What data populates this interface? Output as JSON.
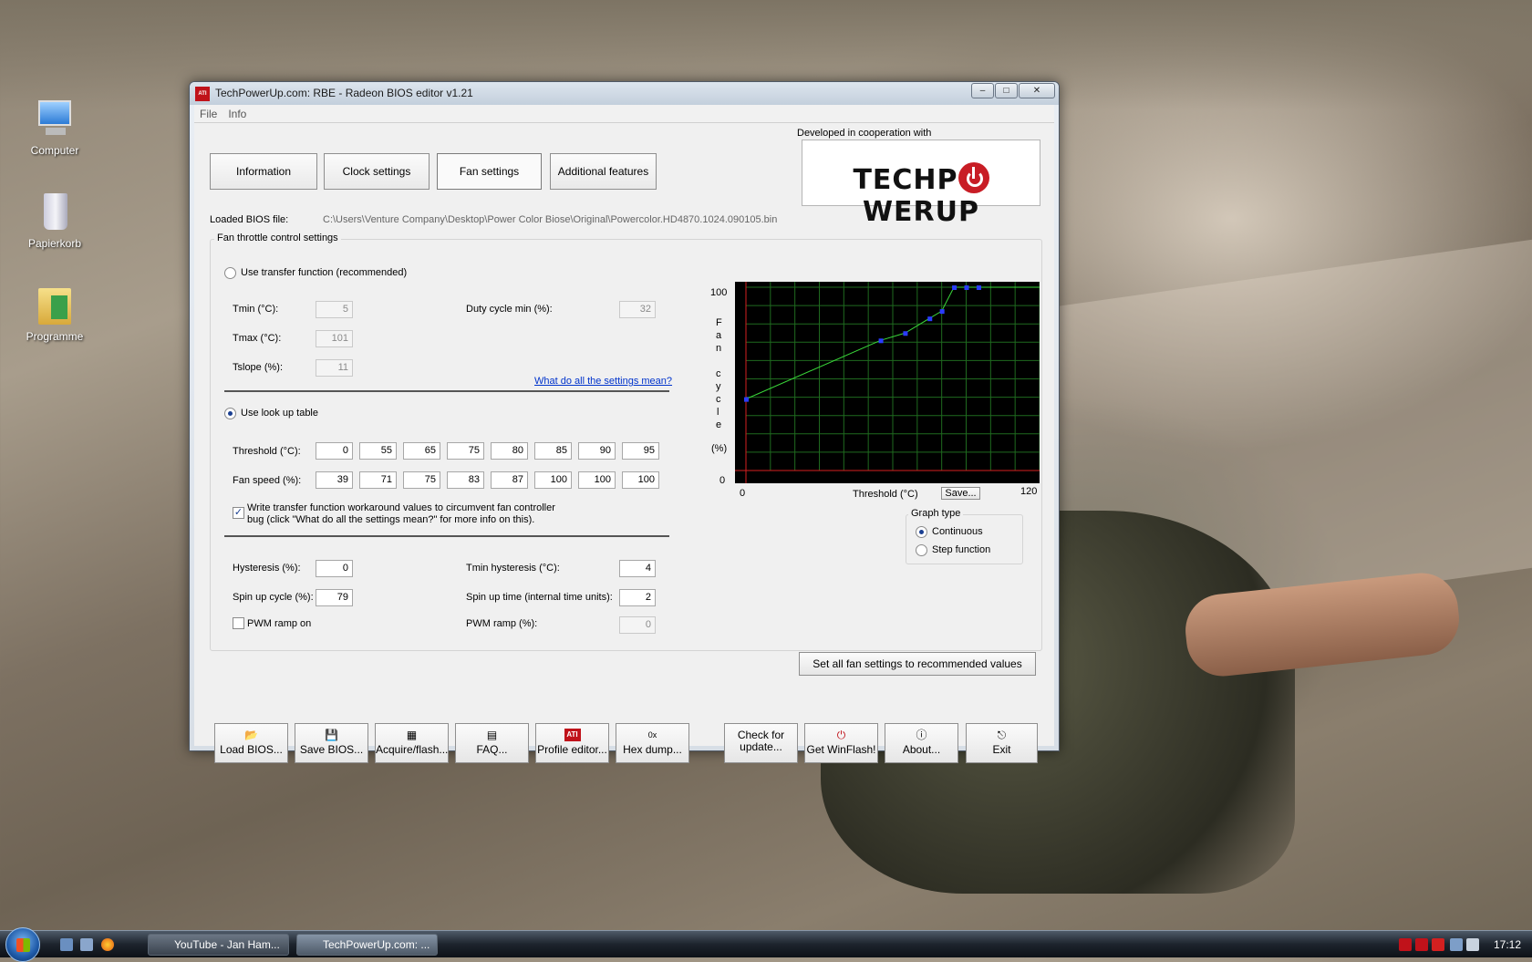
{
  "desktop": {
    "icons": [
      {
        "label": "Computer"
      },
      {
        "label": "Papierkorb"
      },
      {
        "label": "Programme"
      }
    ]
  },
  "window": {
    "title": "TechPowerUp.com: RBE - Radeon BIOS editor v1.21",
    "controls": {
      "minimize": "–",
      "maximize": "□",
      "close": "✕"
    },
    "menu": [
      "File",
      "Info"
    ],
    "tabs": [
      "Information",
      "Clock settings",
      "Fan settings",
      "Additional features"
    ],
    "active_tab": "Fan settings",
    "cooperation_label": "Developed in cooperation with",
    "logo": {
      "left": "TECHP",
      "right": "WERUP"
    },
    "loaded_bios_label": "Loaded BIOS file:",
    "loaded_bios_path": "C:\\Users\\Venture Company\\Desktop\\Power Color Biose\\Original\\Powercolor.HD4870.1024.090105.bin",
    "fan_group_title": "Fan throttle control settings",
    "transfer_function": {
      "label": "Use transfer function (recommended)",
      "selected": false,
      "tmin_label": "Tmin (°C):",
      "tmin": "5",
      "tmax_label": "Tmax (°C):",
      "tmax": "101",
      "tslope_label": "Tslope (%):",
      "tslope": "11",
      "duty_label": "Duty cycle min (%):",
      "duty": "32"
    },
    "help_link": "What do all the settings mean?",
    "lookup_table": {
      "label": "Use look up table",
      "selected": true,
      "threshold_label": "Threshold (°C):",
      "thresholds": [
        "0",
        "55",
        "65",
        "75",
        "80",
        "85",
        "90",
        "95"
      ],
      "fan_speed_label": "Fan speed (%):",
      "fan_speeds": [
        "39",
        "71",
        "75",
        "83",
        "87",
        "100",
        "100",
        "100"
      ]
    },
    "workaround": {
      "checked": true,
      "line1": "Write transfer function workaround values to circumvent fan controller",
      "line2": "bug (click \"What do all the settings mean?\" for more info on this)."
    },
    "hysteresis_label": "Hysteresis (%):",
    "hysteresis": "0",
    "tmin_hysteresis_label": "Tmin hysteresis (°C):",
    "tmin_hysteresis": "4",
    "spin_up_cycle_label": "Spin up cycle (%):",
    "spin_up_cycle": "79",
    "spin_up_time_label": "Spin up time (internal time units):",
    "spin_up_time": "2",
    "pwm_ramp_on_label": "PWM ramp on",
    "pwm_ramp_on": false,
    "pwm_ramp_label": "PWM ramp (%):",
    "pwm_ramp": "0",
    "graph": {
      "y_top": "100",
      "y_bottom": "0",
      "y_title_letters": [
        "F",
        "a",
        "n",
        "",
        "c",
        "y",
        "c",
        "l",
        "e"
      ],
      "y_unit": "(%)",
      "x_left": "0",
      "x_title": "Threshold (°C)",
      "x_right": "120",
      "save_label": "Save..."
    },
    "graph_type": {
      "title": "Graph type",
      "options": [
        "Continuous",
        "Step function"
      ],
      "selected": "Continuous"
    },
    "recommend_button": "Set all fan settings to recommended values",
    "toolbar": [
      {
        "icon": "📂",
        "label": "Load BIOS..."
      },
      {
        "icon": "💾",
        "label": "Save BIOS..."
      },
      {
        "icon": "▦",
        "label": "Acquire/flash..."
      },
      {
        "icon": "▤",
        "label": "FAQ..."
      },
      {
        "icon": "ATI",
        "label": "Profile editor..."
      },
      {
        "icon": "0x",
        "label": "Hex dump..."
      },
      {
        "icon": "",
        "label": "Check for update..."
      },
      {
        "icon": "⏻",
        "label": "Get WinFlash!"
      },
      {
        "icon": "ⓘ",
        "label": "About..."
      },
      {
        "icon": "⎋",
        "label": "Exit"
      }
    ]
  },
  "chart_data": {
    "type": "line",
    "title": "",
    "xlabel": "Threshold (°C)",
    "ylabel": "Fan cycle (%)",
    "xlim": [
      0,
      120
    ],
    "ylim": [
      0,
      100
    ],
    "grid": true,
    "series": [
      {
        "x": [
          0,
          55,
          65,
          75,
          80,
          85,
          90,
          95,
          120
        ],
        "values": [
          39,
          71,
          75,
          83,
          87,
          100,
          100,
          100,
          100
        ]
      }
    ]
  },
  "taskbar": {
    "buttons": [
      {
        "label": "YouTube - Jan Ham...",
        "active": false
      },
      {
        "label": "TechPowerUp.com: ...",
        "active": true
      }
    ],
    "clock": "17:12"
  }
}
